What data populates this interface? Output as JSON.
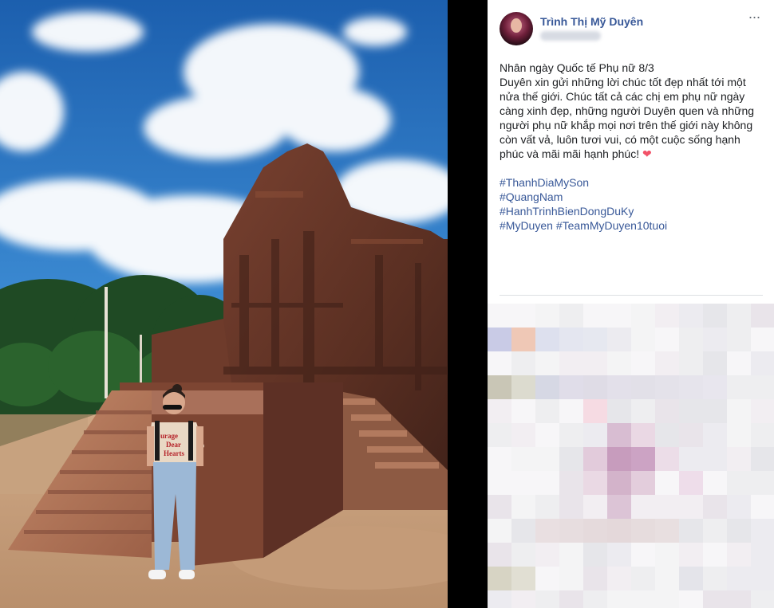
{
  "post": {
    "author": "Trình Thị Mỹ Duyên",
    "more_label": "···",
    "caption_lines": [
      "Nhân ngày Quốc tế Phụ nữ 8/3",
      "Duyên xin gửi những lời chúc tốt đẹp nhất tới một",
      "nửa thế giới. Chúc tất cả các chị em phụ nữ ngày",
      "càng xinh đẹp, những người Duyên quen và những",
      "người phụ nữ khắp mọi nơi trên thế giới này không",
      "còn vất vả, luôn tươi vui, có một cuộc sống hạnh",
      "phúc và mãi mãi hạnh phúc!"
    ],
    "heart": "❤",
    "hashtags": [
      "#ThanhDiaMySon",
      "#QuangNam",
      "#HanhTrinhBienDongDuKy",
      "#MyDuyen",
      "#TeamMyDuyen10tuoi"
    ]
  },
  "photo": {
    "shirt_text": [
      "urage",
      "Dear",
      "Hearts"
    ]
  },
  "colors": {
    "link": "#385898",
    "sky": "#2b70b8",
    "brick": "#6b3a2a"
  }
}
